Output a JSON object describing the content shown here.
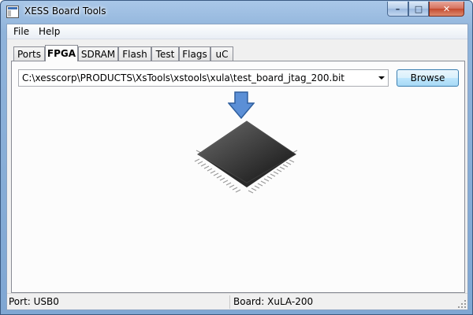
{
  "window": {
    "title": "XESS Board Tools"
  },
  "menubar": {
    "items": [
      {
        "label": "File"
      },
      {
        "label": "Help"
      }
    ]
  },
  "tabs": [
    {
      "label": "Ports"
    },
    {
      "label": "FPGA"
    },
    {
      "label": "SDRAM"
    },
    {
      "label": "Flash"
    },
    {
      "label": "Test"
    },
    {
      "label": "Flags"
    },
    {
      "label": "uC"
    }
  ],
  "active_tab": "FPGA",
  "fpga": {
    "file_path": "C:\\xesscorp\\PRODUCTS\\XsTools\\xstools\\xula\\test_board_jtag_200.bit",
    "browse_label": "Browse"
  },
  "statusbar": {
    "port": "Port: USB0",
    "board": "Board: XuLA-200"
  },
  "colors": {
    "arrow_fill": "#5b8fd6",
    "chip_body": "#1c1c1c",
    "titlebar": "#8fb3da"
  },
  "icons": {
    "download_arrow": "arrow-down-icon",
    "chip": "fpga-chip-icon"
  }
}
